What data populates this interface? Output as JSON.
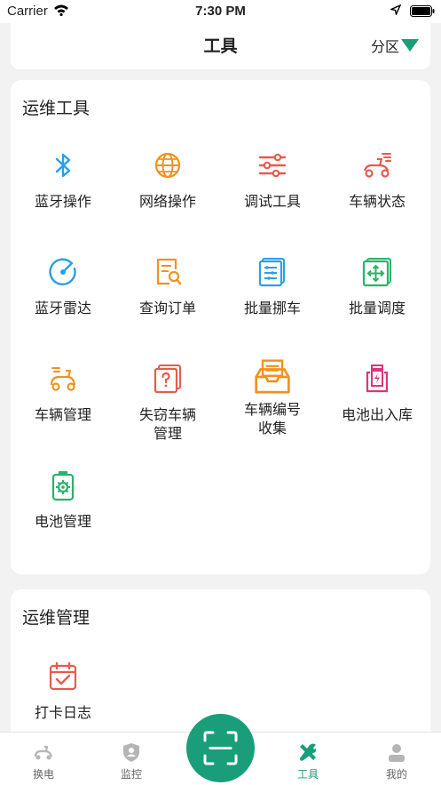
{
  "status_bar": {
    "carrier": "Carrier",
    "time": "7:30 PM"
  },
  "header": {
    "title": "工具",
    "region_label": "分区"
  },
  "ops_tools": {
    "title": "运维工具",
    "items": [
      {
        "label": "蓝牙操作",
        "icon": "bluetooth-icon",
        "color": "#2b9fe6"
      },
      {
        "label": "网络操作",
        "icon": "globe-icon",
        "color": "#f0921f"
      },
      {
        "label": "调试工具",
        "icon": "sliders-icon",
        "color": "#e85a4f"
      },
      {
        "label": "车辆状态",
        "icon": "scooter-icon",
        "color": "#e85a4f"
      },
      {
        "label": "蓝牙雷达",
        "icon": "radar-icon",
        "color": "#2b9fe6"
      },
      {
        "label": "查询订单",
        "icon": "order-search-icon",
        "color": "#f0921f"
      },
      {
        "label": "批量挪车",
        "icon": "list-icon",
        "color": "#2b9fe6"
      },
      {
        "label": "批量调度",
        "icon": "move-icon",
        "color": "#2ab36a"
      },
      {
        "label": "车辆管理",
        "icon": "vehicle-manage-icon",
        "color": "#f0921f"
      },
      {
        "label": "失窃车辆\n管理",
        "icon": "stolen-icon",
        "color": "#e85a4f"
      },
      {
        "label": "车辆编号\n收集",
        "icon": "inbox-icon",
        "color": "#f0921f"
      },
      {
        "label": "电池出入库",
        "icon": "battery-charge-icon",
        "color": "#d9367c"
      },
      {
        "label": "电池管理",
        "icon": "battery-gear-icon",
        "color": "#2ab36a"
      }
    ]
  },
  "ops_manage": {
    "title": "运维管理",
    "items": [
      {
        "label": "打卡日志",
        "icon": "calendar-check-icon",
        "color": "#e85a4f"
      }
    ]
  },
  "tabbar": {
    "tabs": [
      {
        "label": "换电",
        "icon": "scooter-tab-icon"
      },
      {
        "label": "监控",
        "icon": "shield-tab-icon"
      },
      {
        "label": "工具",
        "icon": "tools-tab-icon",
        "active": true
      },
      {
        "label": "我的",
        "icon": "user-tab-icon"
      }
    ],
    "accent": "#1a9e7a"
  }
}
